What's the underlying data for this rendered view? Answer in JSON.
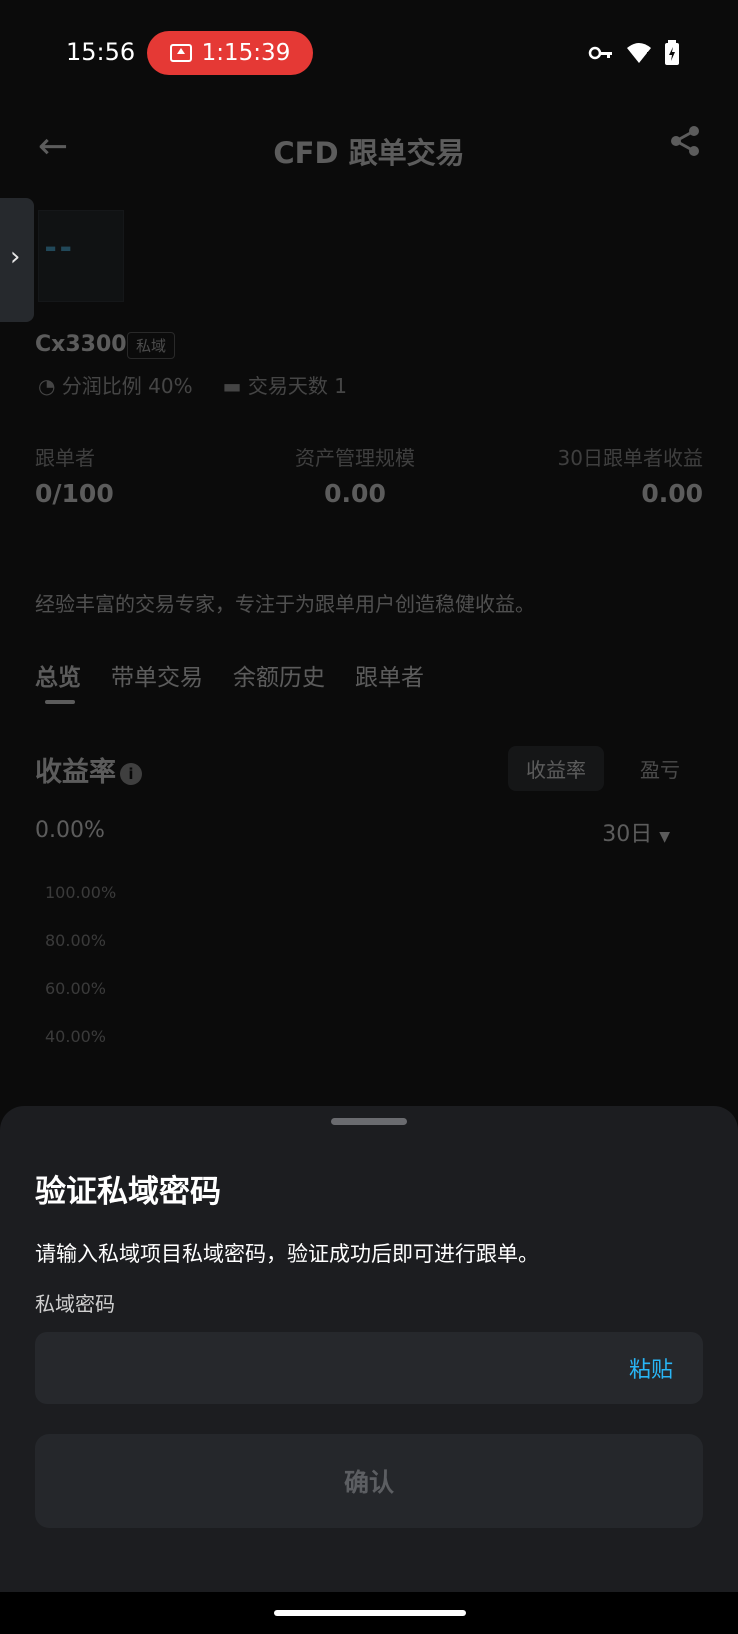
{
  "status_bar": {
    "time": "15:56",
    "recording_time": "1:15:39",
    "icons": [
      "key-icon",
      "wifi-icon",
      "battery-icon"
    ]
  },
  "app_bar": {
    "title": "CFD 跟单交易",
    "back_icon": "arrow-left-icon",
    "share_icon": "share-icon"
  },
  "profile": {
    "name": "Cx3300",
    "badge": "私域",
    "profit_share_label": "分润比例",
    "profit_share_value": "40%",
    "trade_days_label": "交易天数",
    "trade_days_value": "1"
  },
  "stats": [
    {
      "label": "跟单者",
      "value_main": "0",
      "value_suffix": "/100"
    },
    {
      "label": "资产管理规模",
      "value_main": "0.00"
    },
    {
      "label": "30日跟单者收益",
      "value_main": "0.00"
    }
  ],
  "description": "经验丰富的交易专家，专注于为跟单用户创造稳健收益。",
  "tabs": [
    "总览",
    "带单交易",
    "余额历史",
    "跟单者"
  ],
  "overview": {
    "title": "收益率",
    "toggle": [
      "收益率",
      "盈亏"
    ],
    "rate_value": "0.00%",
    "period": "30日",
    "y_ticks": [
      "100.00%",
      "80.00%",
      "60.00%",
      "40.00%"
    ]
  },
  "sheet": {
    "title": "验证私域密码",
    "description": "请输入私域项目私域密码，验证成功后即可进行跟单。",
    "field_label": "私域密码",
    "input_value": "",
    "input_placeholder": "",
    "paste_label": "粘贴",
    "confirm_label": "确认"
  },
  "colors": {
    "accent": "#29b6f6",
    "record_pill": "#e53935",
    "sheet_bg": "#1c1d20"
  }
}
